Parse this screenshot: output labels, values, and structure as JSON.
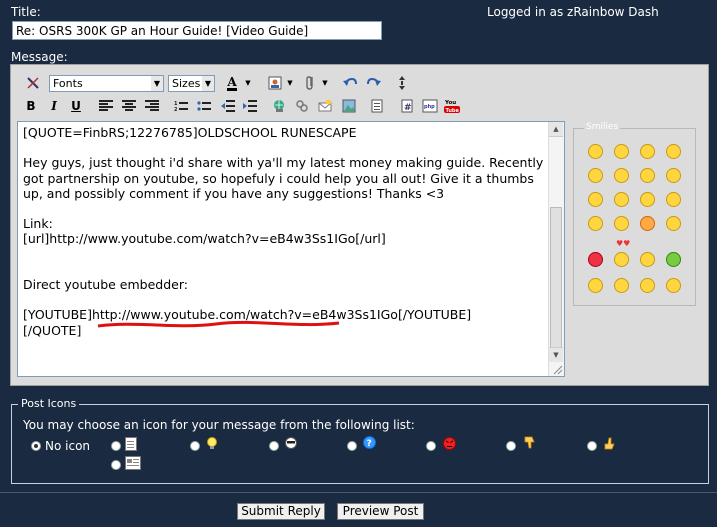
{
  "form": {
    "title_label": "Title:",
    "title_value": "Re: OSRS 300K GP an Hour Guide! [Video Guide]",
    "logged_in": "Logged in as zRainbow Dash",
    "message_label": "Message:"
  },
  "toolbar": {
    "font_select": "Fonts",
    "size_select": "Sizes",
    "bold": "B",
    "italic": "I",
    "underline": "U",
    "text_color": "A"
  },
  "message_text": "[QUOTE=FinbRS;12276785]OLDSCHOOL RUNESCAPE\n\nHey guys, just thought i'd share with ya'll my latest money making guide. Recently got partnership on youtube, so hopefuly i could help you all out! Give it a thumbs up, and possibly comment if you have any suggestions! Thanks <3\n\nLink:\n[url]http://www.youtube.com/watch?v=eB4w3Ss1IGo[/url]\n\n\nDirect youtube embedder:\n\n[YOUTUBE]http://www.youtube.com/watch?v=eB4w3Ss1IGo[/YOUTUBE]\n[/QUOTE]",
  "smilies_label": "Smilies",
  "post_icons": {
    "legend": "Post Icons",
    "instruction": "You may choose an icon for your message from the following list:",
    "no_icon_label": "No icon",
    "selected": "No icon"
  },
  "buttons": {
    "submit": "Submit Reply",
    "preview": "Preview Post"
  },
  "colors": {
    "page_bg": "#1a2a40",
    "editor_bg": "#dcdcdc"
  }
}
